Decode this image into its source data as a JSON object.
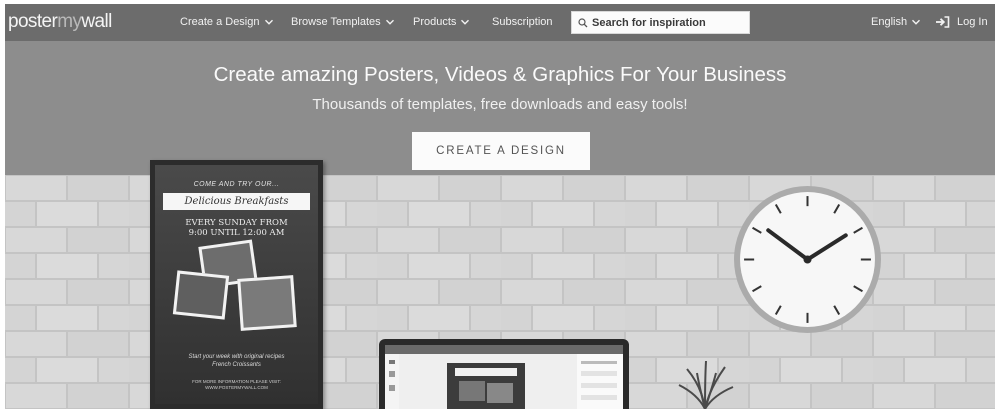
{
  "brand": {
    "logo_left": "poster",
    "logo_mid": "my",
    "logo_right": "wall"
  },
  "nav": {
    "create": "Create a Design",
    "browse": "Browse Templates",
    "products": "Products",
    "subscription": "Subscription",
    "search_placeholder": "Search for inspiration",
    "language": "English",
    "login": "Log In"
  },
  "hero": {
    "title": "Create amazing Posters, Videos & Graphics For Your Business",
    "subtitle": "Thousands of templates, free downloads and easy tools!",
    "cta": "CREATE A DESIGN"
  },
  "poster": {
    "top_line": "COME AND TRY OUR...",
    "title": "Delicious Breakfasts",
    "line1": "EVERY SUNDAY FROM",
    "line2": "9:00 UNTIL 12:00 AM",
    "footer1a": "Start your week with original recipes",
    "footer1b": "French Croissants",
    "footer2a": "FOR MORE INFORMATION PLEASE VISIT:",
    "footer2b": "WWW.POSTERMYWALL.COM"
  },
  "icons": {
    "chevron": "chevron-down-icon",
    "search": "search-icon",
    "login": "login-arrow-icon"
  },
  "colors": {
    "nav_bg": "#6c6c6c",
    "hero_bg": "#8d8d8d",
    "button_bg": "#fbfbfb",
    "wall": "#cfcfcf"
  }
}
